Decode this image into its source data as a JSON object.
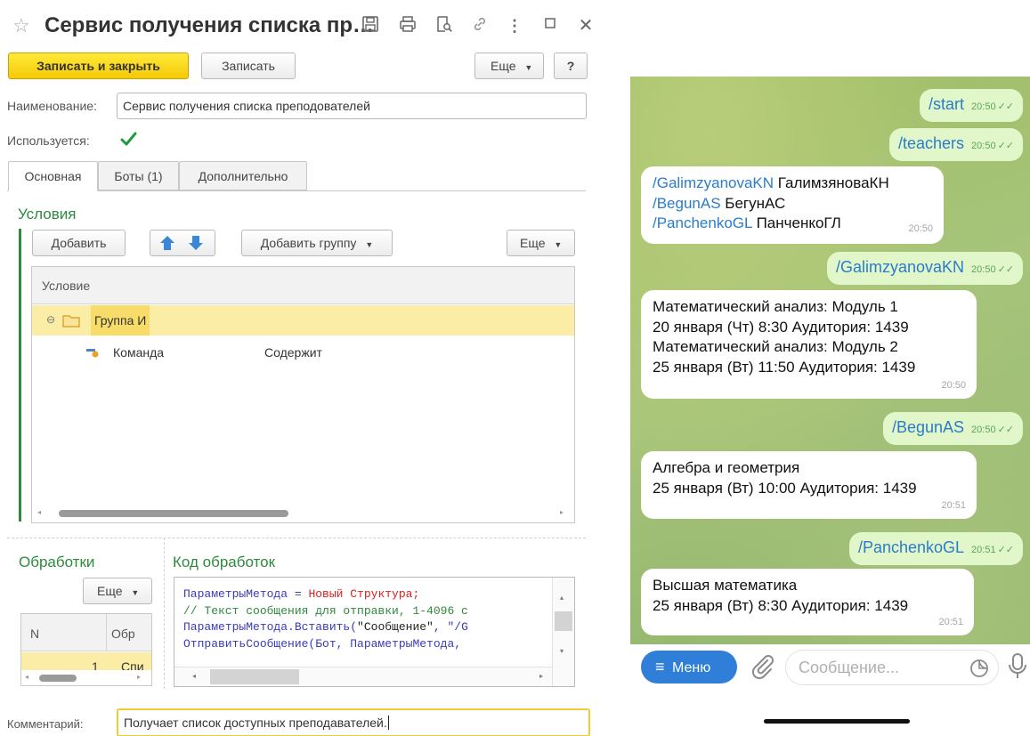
{
  "form": {
    "title": "Сервис получения списка пр…",
    "toolbar": {
      "save_close": "Записать и закрыть",
      "save": "Записать",
      "more": "Еще",
      "help": "?"
    },
    "name_label": "Наименование:",
    "name_value": "Сервис получения списка преподователей",
    "used_label": "Используется:",
    "used_checked": true,
    "tabs": [
      "Основная",
      "Боты (1)",
      "Дополнительно"
    ],
    "conditions": {
      "title": "Условия",
      "add": "Добавить",
      "add_group": "Добавить группу",
      "more": "Еще",
      "column": "Условие",
      "group_label": "Группа И",
      "row_command": "Команда",
      "row_operator": "Содержит"
    },
    "handlers": {
      "title": "Обработки",
      "more": "Еще",
      "col_n": "N",
      "col_name": "Обр",
      "row_n": "1",
      "row_name": "Спи"
    },
    "code": {
      "title": "Код обработок",
      "line1a": "ПараметрыМетода = ",
      "line1b": "Новый Структура",
      "line1c": ";",
      "line2": "// Текст сообщения для отправки, 1-4096 с",
      "line3a": "ПараметрыМетода.Вставить(",
      "line3b": "\"Сообщение\"",
      "line3c": ", \"/G",
      "line4": "ОтправитьСообщение(Бот, ПараметрыМетода,"
    },
    "comment_label": "Комментарий:",
    "comment_value": "Получает список доступных преподавателей."
  },
  "telegram": {
    "messages": {
      "m1": {
        "text": "/start",
        "time": "20:50"
      },
      "m2": {
        "text": "/teachers",
        "time": "20:50"
      },
      "m3": {
        "l1_link": "/GalimzyanovaKN",
        "l1_text": " ГалимзяноваКН",
        "l2_link": "/BegunAS",
        "l2_text": " БегунАС",
        "l3_link": "/PanchenkoGL",
        "l3_text": " ПанченкоГЛ",
        "time": "20:50"
      },
      "m4": {
        "text": "/GalimzyanovaKN",
        "time": "20:50"
      },
      "m5": {
        "l1": "Математический анализ: Модуль 1",
        "l2": "20 января (Чт) 8:30 Аудитория: 1439",
        "l3": "Математический анализ: Модуль 2",
        "l4": "25 января (Вт) 11:50 Аудитория: 1439",
        "time": "20:50"
      },
      "m6": {
        "text": "/BegunAS",
        "time": "20:50"
      },
      "m7": {
        "l1": "Алгебра и геометрия",
        "l2": "25 января (Вт) 10:00 Аудитория: 1439",
        "time": "20:51"
      },
      "m8": {
        "text": "/PanchenkoGL",
        "time": "20:51"
      },
      "m9": {
        "l1": "Высшая математика",
        "l2": "25 января (Вт) 8:30 Аудитория: 1439",
        "time": "20:51"
      }
    },
    "input": {
      "menu": "Меню",
      "placeholder": "Сообщение..."
    },
    "colors": {
      "menu_button": "#2f7ed8",
      "link": "#2a7cc9",
      "outgoing_bubble": "#e2f7c9"
    }
  }
}
